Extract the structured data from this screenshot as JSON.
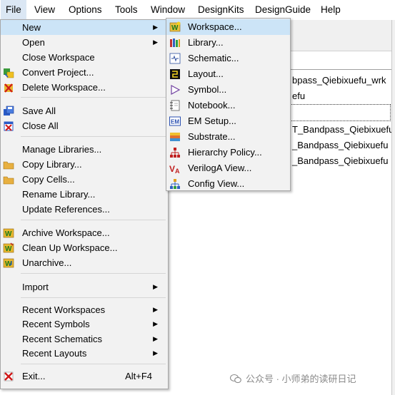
{
  "menubar": {
    "items": [
      {
        "label": "File"
      },
      {
        "label": "View"
      },
      {
        "label": "Options"
      },
      {
        "label": "Tools"
      },
      {
        "label": "Window"
      },
      {
        "label": "DesignKits"
      },
      {
        "label": "DesignGuide"
      },
      {
        "label": "Help"
      }
    ]
  },
  "background": {
    "tree": [
      {
        "text": "bpass_Qiebixuefu_wrk"
      },
      {
        "text": "efu"
      },
      {
        "text": "T_Bandpass_Qiebixuefu"
      },
      {
        "text": "_Bandpass_Qiebixuefu"
      },
      {
        "text": "_Bandpass_Qiebixuefu"
      }
    ]
  },
  "file_menu": {
    "items": [
      {
        "label": "New",
        "icon": "none",
        "submenu": true
      },
      {
        "label": "Open",
        "icon": "none",
        "submenu": true
      },
      {
        "label": "Close Workspace",
        "icon": "none"
      },
      {
        "label": "Convert Project...",
        "icon": "convert-project-icon"
      },
      {
        "label": "Delete Workspace...",
        "icon": "delete-workspace-icon"
      },
      {
        "label": "Save All",
        "icon": "save-all-icon"
      },
      {
        "label": "Close All",
        "icon": "close-all-icon"
      },
      {
        "label": "Manage Libraries...",
        "icon": "none"
      },
      {
        "label": "Copy Library...",
        "icon": "folder-icon"
      },
      {
        "label": "Copy Cells...",
        "icon": "folder-icon"
      },
      {
        "label": "Rename Library...",
        "icon": "none"
      },
      {
        "label": "Update References...",
        "icon": "none"
      },
      {
        "label": "Archive Workspace...",
        "icon": "archive-workspace-icon"
      },
      {
        "label": "Clean Up Workspace...",
        "icon": "clean-workspace-icon"
      },
      {
        "label": "Unarchive...",
        "icon": "unarchive-icon"
      },
      {
        "label": "Import",
        "icon": "none",
        "submenu": true
      },
      {
        "label": "Recent Workspaces",
        "icon": "none",
        "submenu": true
      },
      {
        "label": "Recent Symbols",
        "icon": "none",
        "submenu": true
      },
      {
        "label": "Recent Schematics",
        "icon": "none",
        "submenu": true
      },
      {
        "label": "Recent Layouts",
        "icon": "none",
        "submenu": true
      },
      {
        "label": "Exit...",
        "icon": "exit-icon",
        "shortcut": "Alt+F4"
      }
    ]
  },
  "new_submenu": {
    "items": [
      {
        "label": "Workspace...",
        "icon": "workspace-icon"
      },
      {
        "label": "Library...",
        "icon": "library-icon"
      },
      {
        "label": "Schematic...",
        "icon": "schematic-icon"
      },
      {
        "label": "Layout...",
        "icon": "layout-icon"
      },
      {
        "label": "Symbol...",
        "icon": "symbol-icon"
      },
      {
        "label": "Notebook...",
        "icon": "notebook-icon"
      },
      {
        "label": "EM Setup...",
        "icon": "em-setup-icon"
      },
      {
        "label": "Substrate...",
        "icon": "substrate-icon"
      },
      {
        "label": "Hierarchy Policy...",
        "icon": "hierarchy-policy-icon"
      },
      {
        "label": "VerilogA View...",
        "icon": "veriloga-icon"
      },
      {
        "label": "Config View...",
        "icon": "config-view-icon"
      }
    ]
  },
  "watermark": {
    "text": "公众号 · 小师弟的读研日记"
  },
  "colors": {
    "highlight": "#cce4f7",
    "menubar_active": "#dbe7f4",
    "menu_bg": "#f2f2f2"
  }
}
